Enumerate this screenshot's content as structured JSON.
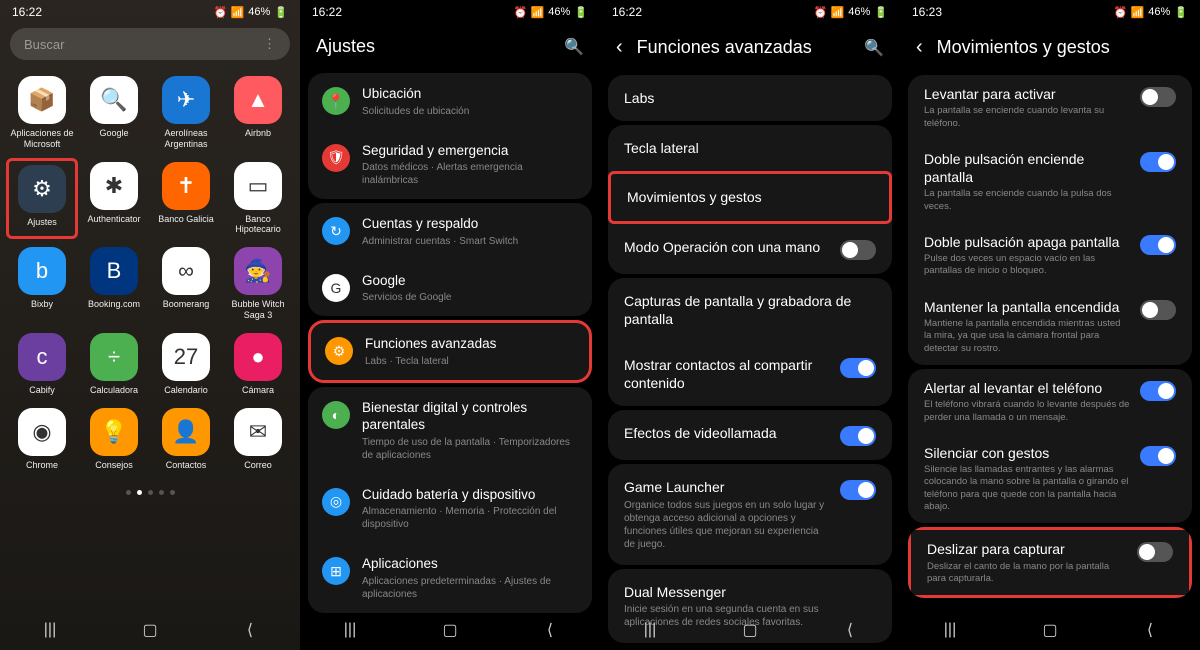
{
  "status": {
    "time1": "16:22",
    "time2": "16:22",
    "time3": "16:22",
    "time4": "16:23",
    "battery": "46%"
  },
  "p1": {
    "search": "Buscar",
    "apps": [
      {
        "label": "Aplicaciones de Microsoft",
        "bg": "#fff"
      },
      {
        "label": "Google",
        "bg": "#fff"
      },
      {
        "label": "Aerolíneas Argentinas",
        "bg": "#1976d2"
      },
      {
        "label": "Airbnb",
        "bg": "#ff5a5f"
      },
      {
        "label": "Ajustes",
        "bg": "#2c3e50"
      },
      {
        "label": "Authenticator",
        "bg": "#fff"
      },
      {
        "label": "Banco Galicia",
        "bg": "#ff6600"
      },
      {
        "label": "Banco Hipotecario",
        "bg": "#fff"
      },
      {
        "label": "Bixby",
        "bg": "#2196f3"
      },
      {
        "label": "Booking.com",
        "bg": "#003580"
      },
      {
        "label": "Boomerang",
        "bg": "#fff"
      },
      {
        "label": "Bubble Witch Saga 3",
        "bg": "#8e44ad"
      },
      {
        "label": "Cabify",
        "bg": "#6b3fa0"
      },
      {
        "label": "Calculadora",
        "bg": "#4caf50"
      },
      {
        "label": "Calendario",
        "bg": "#fff"
      },
      {
        "label": "Cámara",
        "bg": "#e91e63"
      },
      {
        "label": "Chrome",
        "bg": "#fff"
      },
      {
        "label": "Consejos",
        "bg": "#ff9800"
      },
      {
        "label": "Contactos",
        "bg": "#ff9800"
      },
      {
        "label": "Correo",
        "bg": "#fff"
      }
    ]
  },
  "p2": {
    "title": "Ajustes",
    "items": [
      {
        "icon": "📍",
        "iconBg": "#4caf50",
        "title": "Ubicación",
        "sub": "Solicitudes de ubicación"
      },
      {
        "icon": "🛡",
        "iconBg": "#e53935",
        "title": "Seguridad y emergencia",
        "sub": "Datos médicos · Alertas emergencia inalámbricas"
      },
      {
        "icon": "↻",
        "iconBg": "#2196f3",
        "title": "Cuentas y respaldo",
        "sub": "Administrar cuentas · Smart Switch"
      },
      {
        "icon": "G",
        "iconBg": "#fff",
        "title": "Google",
        "sub": "Servicios de Google"
      },
      {
        "icon": "⚙",
        "iconBg": "#ff9800",
        "title": "Funciones avanzadas",
        "sub": "Labs · Tecla lateral"
      },
      {
        "icon": "◐",
        "iconBg": "#4caf50",
        "title": "Bienestar digital y controles parentales",
        "sub": "Tiempo de uso de la pantalla · Temporizadores de aplicaciones"
      },
      {
        "icon": "◎",
        "iconBg": "#2196f3",
        "title": "Cuidado batería y dispositivo",
        "sub": "Almacenamiento · Memoria · Protección del dispositivo"
      },
      {
        "icon": "⊞",
        "iconBg": "#2196f3",
        "title": "Aplicaciones",
        "sub": "Aplicaciones predeterminadas · Ajustes de aplicaciones"
      }
    ]
  },
  "p3": {
    "title": "Funciones avanzadas",
    "items": [
      {
        "title": "Labs"
      },
      {
        "title": "Tecla lateral"
      },
      {
        "title": "Movimientos y gestos"
      },
      {
        "title": "Modo Operación con una mano",
        "toggle": "off"
      },
      {
        "title": "Capturas de pantalla y grabadora de pantalla"
      },
      {
        "title": "Mostrar contactos al compartir contenido",
        "toggle": "on"
      },
      {
        "title": "Efectos de videollamada",
        "toggle": "on"
      },
      {
        "title": "Game Launcher",
        "sub": "Organice todos sus juegos en un solo lugar y obtenga acceso adicional a opciones y funciones útiles que mejoran su experiencia de juego.",
        "toggle": "on"
      },
      {
        "title": "Dual Messenger",
        "sub": "Inicie sesión en una segunda cuenta en sus aplicaciones de redes sociales favoritas."
      }
    ]
  },
  "p4": {
    "title": "Movimientos y gestos",
    "items": [
      {
        "title": "Levantar para activar",
        "sub": "La pantalla se enciende cuando levanta su teléfono.",
        "toggle": "off"
      },
      {
        "title": "Doble pulsación enciende pantalla",
        "sub": "La pantalla se enciende cuando la pulsa dos veces.",
        "toggle": "on"
      },
      {
        "title": "Doble pulsación apaga pantalla",
        "sub": "Pulse dos veces un espacio vacío en las pantallas de inicio o bloqueo.",
        "toggle": "on"
      },
      {
        "title": "Mantener la pantalla encendida",
        "sub": "Mantiene la pantalla encendida mientras usted la mira, ya que usa la cámara frontal para detectar su rostro.",
        "toggle": "off"
      },
      {
        "title": "Alertar al levantar el teléfono",
        "sub": "El teléfono vibrará cuando lo levante después de perder una llamada o un mensaje.",
        "toggle": "on"
      },
      {
        "title": "Silenciar con gestos",
        "sub": "Silencie las llamadas entrantes y las alarmas colocando la mano sobre la pantalla o girando el teléfono para que quede con la pantalla hacia abajo.",
        "toggle": "on"
      },
      {
        "title": "Deslizar para capturar",
        "sub": "Deslizar el canto de la mano por la pantalla para capturarla.",
        "toggle": "off"
      }
    ]
  }
}
